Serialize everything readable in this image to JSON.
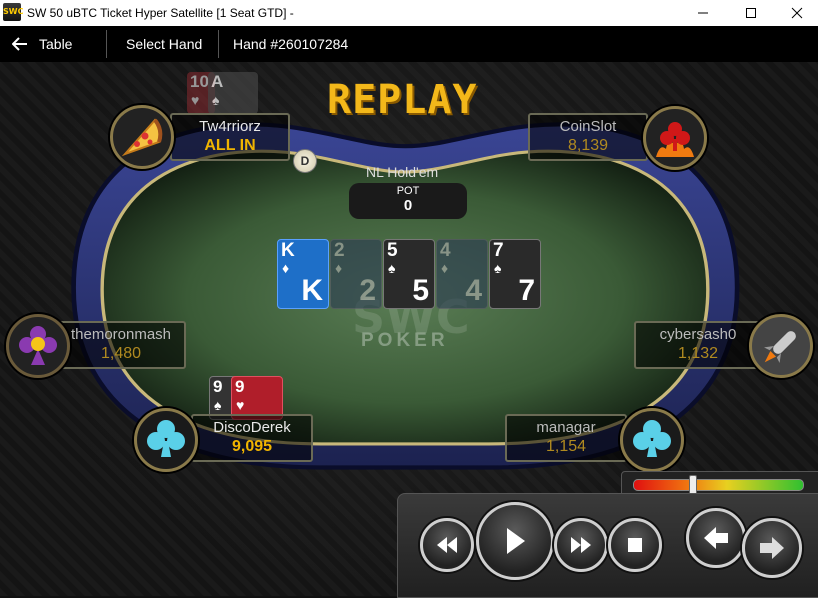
{
  "window": {
    "app_icon_label": "SWC",
    "title": "SW 50 uBTC Ticket Hyper Satellite [1 Seat GTD]  -"
  },
  "nav": {
    "back_label": "Table",
    "select_hand_label": "Select Hand",
    "hand_label": "Hand #260107284"
  },
  "replay_title": "REPLAY",
  "game": {
    "type": "NL Hold'em",
    "pot_label": "POT",
    "pot_value": "0",
    "dealer_label": "D",
    "watermark_logo": "SWC",
    "watermark_text": "POKER"
  },
  "board": [
    {
      "rank": "K",
      "suit": "♦",
      "color": "#1e6fc8",
      "dim": false
    },
    {
      "rank": "2",
      "suit": "♦",
      "color": "#2d3e52",
      "dim": true
    },
    {
      "rank": "5",
      "suit": "♠",
      "color": "#2a2a2a",
      "dim": false
    },
    {
      "rank": "4",
      "suit": "♦",
      "color": "#2d3e52",
      "dim": true
    },
    {
      "rank": "7",
      "suit": "♠",
      "color": "#2a2a2a",
      "dim": false
    }
  ],
  "players": {
    "tw4rriorz": {
      "name": "Tw4rriorz",
      "stack": "ALL IN",
      "avatar": "pizza-icon",
      "cards": [
        {
          "rank": "10",
          "suit": "♥"
        },
        {
          "rank": "A",
          "suit": "♠"
        }
      ]
    },
    "coinslot": {
      "name": "CoinSlot",
      "stack": "8,139",
      "avatar": "club-fire-icon"
    },
    "themoronmash": {
      "name": "themoronmash",
      "stack": "1,480",
      "avatar": "flower-icon"
    },
    "cybersash0": {
      "name": "cybersash0",
      "stack": "1,132",
      "avatar": "rocket-icon"
    },
    "discoderek": {
      "name": "DiscoDerek",
      "stack": "9,095",
      "avatar": "club-icon",
      "cards": [
        {
          "rank": "9",
          "suit": "♠"
        },
        {
          "rank": "9",
          "suit": "♥"
        }
      ]
    },
    "managar": {
      "name": "managar",
      "stack": "1,154",
      "avatar": "club-icon"
    }
  },
  "speed": {
    "level": 0.35
  },
  "colors": {
    "accent": "#f0b400",
    "felt": "#3f6a3a",
    "rail": "#27306a"
  }
}
